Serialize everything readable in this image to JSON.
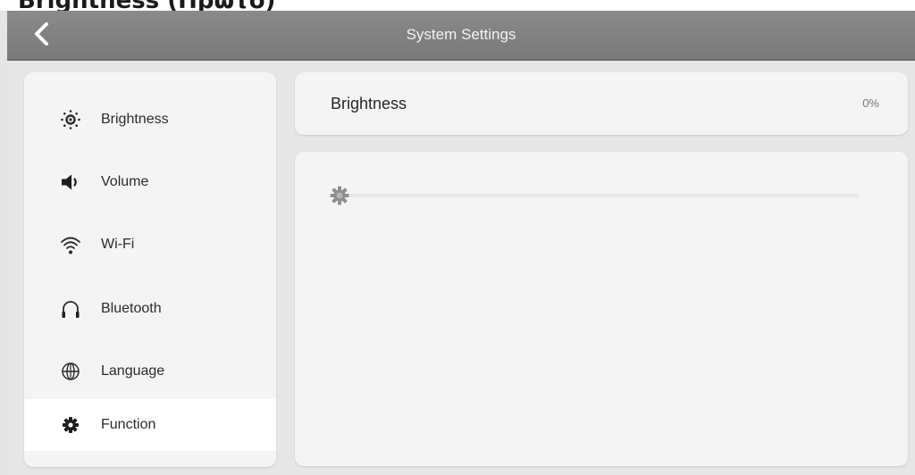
{
  "caption": "Brightness (Πρώτο)",
  "header": {
    "title": "System Settings",
    "back_icon": "chevron-left-icon"
  },
  "sidebar": {
    "items": [
      {
        "label": "Brightness",
        "icon": "sun-icon",
        "active": false
      },
      {
        "label": "Volume",
        "icon": "speaker-icon",
        "active": false
      },
      {
        "label": "Wi-Fi",
        "icon": "wifi-icon",
        "active": false
      },
      {
        "label": "Bluetooth",
        "icon": "headphones-icon",
        "active": false
      },
      {
        "label": "Language",
        "icon": "globe-icon",
        "active": false
      },
      {
        "label": "Function",
        "icon": "gear-icon",
        "active": true
      }
    ]
  },
  "brightness": {
    "title": "Brightness",
    "value_label": "0%",
    "level_percent": 0
  },
  "colors": {
    "header": "#808080",
    "background": "#e4e4e4",
    "card": "#f4f4f4",
    "active_item": "#ffffff"
  }
}
